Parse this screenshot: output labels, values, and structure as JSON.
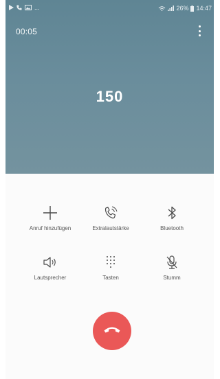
{
  "statusbar": {
    "battery": "26%",
    "time": "14:47",
    "left_text": "..."
  },
  "call": {
    "timer": "00:05",
    "number": "150"
  },
  "controls": [
    {
      "label": "Anruf hinzufügen",
      "icon": "plus-icon"
    },
    {
      "label": "Extralautstärke",
      "icon": "extra-volume-icon"
    },
    {
      "label": "Bluetooth",
      "icon": "bluetooth-icon"
    },
    {
      "label": "Lautsprecher",
      "icon": "speaker-icon"
    },
    {
      "label": "Tasten",
      "icon": "keypad-icon"
    },
    {
      "label": "Stumm",
      "icon": "mute-icon"
    }
  ],
  "colors": {
    "header": "#6a8d9c",
    "end_call": "#ea5857",
    "icon": "#4a4a4a"
  }
}
